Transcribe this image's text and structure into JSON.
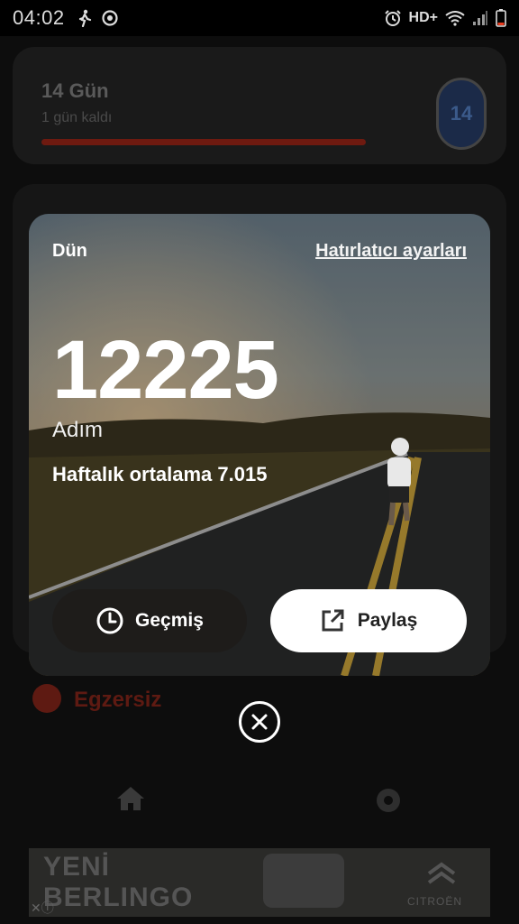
{
  "status_bar": {
    "time": "04:02",
    "network": "HD+",
    "icons": [
      "walk-icon",
      "sync-icon",
      "alarm-icon",
      "wifi-icon",
      "signal-icon",
      "battery-icon"
    ]
  },
  "background_app": {
    "challenge": {
      "title": "14 Gün",
      "subtitle": "1 gün kaldı",
      "badge_number": "14"
    },
    "exercise_label": "Egzersiz",
    "nav": [
      "home-icon",
      "settings-icon"
    ]
  },
  "ad_banner": {
    "text_line1": "YENİ",
    "text_line2": "BERLINGO",
    "brand": "CITROËN"
  },
  "modal": {
    "day_label": "Dün",
    "reminder_link": "Hatırlatıcı ayarları",
    "steps_value": "12225",
    "steps_unit": "Adım",
    "weekly_average": "Haftalık ortalama 7.015",
    "history_button": "Geçmiş",
    "share_button": "Paylaş"
  },
  "colors": {
    "accent": "#e8391c",
    "share_button_bg": "#ffffff",
    "overlay": "#000000"
  }
}
